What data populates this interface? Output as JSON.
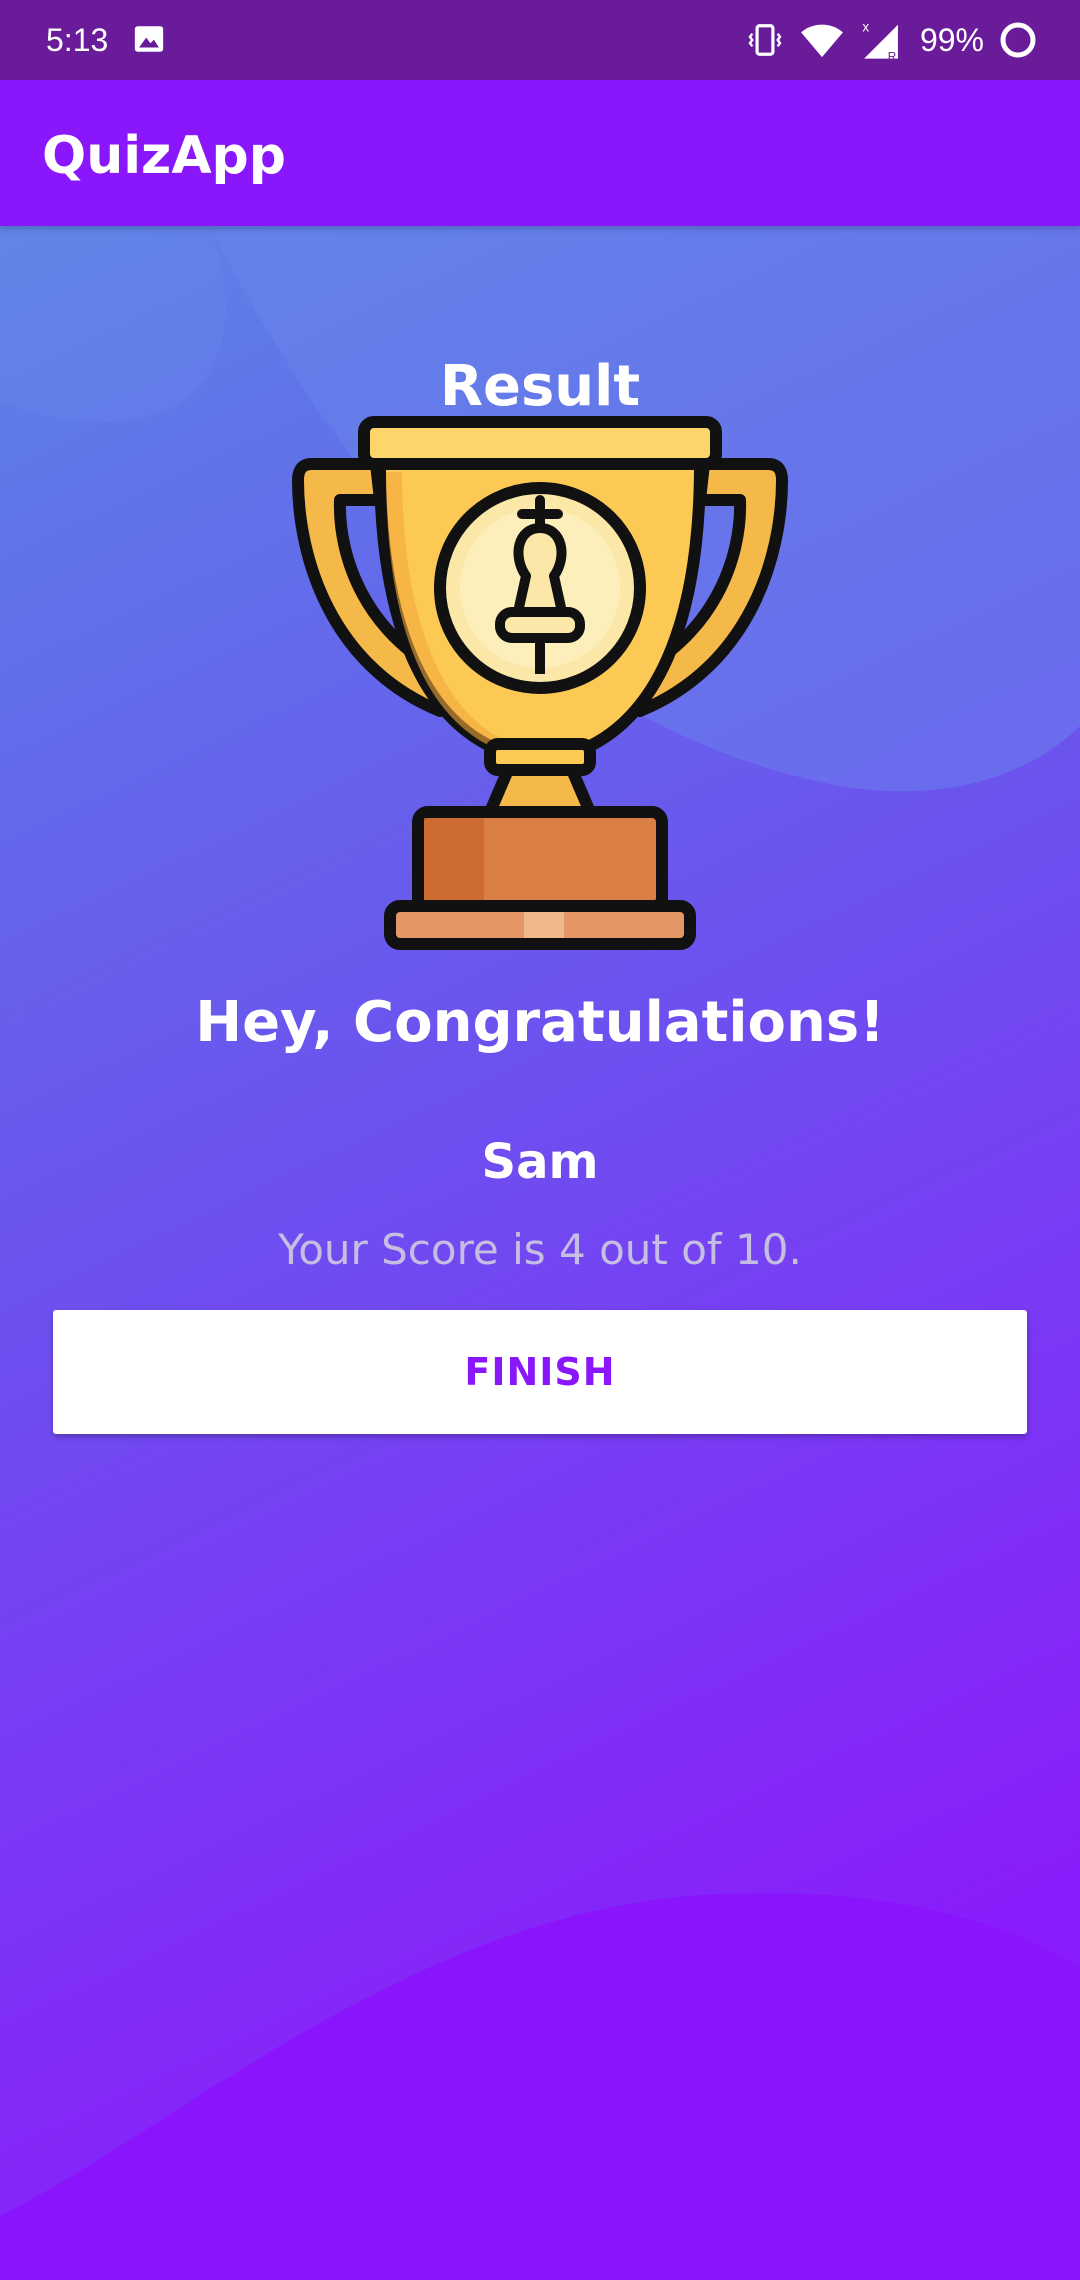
{
  "status_bar": {
    "time": "5:13",
    "battery_percent": "99%",
    "icons": [
      "image-icon",
      "vibrate-icon",
      "wifi-icon",
      "signal-icon",
      "battery-ring-icon"
    ]
  },
  "app_bar": {
    "title": "QuizApp"
  },
  "result": {
    "heading": "Result",
    "trophy_icon": "trophy-icon",
    "congratulations": "Hey, Congratulations!",
    "user_name": "Sam",
    "score_text": "Your Score is 4 out of 10.",
    "finish_label": "FINISH"
  },
  "colors": {
    "app_bar": "#8a17fb",
    "status_bar": "#6a1b9a",
    "button_text": "#8a17fb",
    "gradient_top": "#5a7ee8",
    "gradient_bottom": "#8a17fb"
  }
}
